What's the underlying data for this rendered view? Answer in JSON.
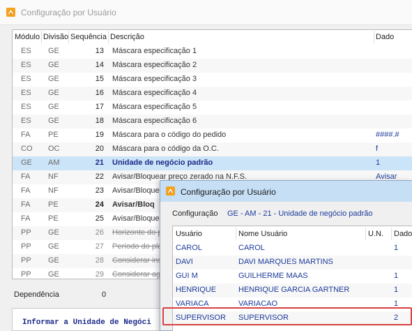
{
  "main_window": {
    "title": "Configuração por Usuário",
    "grid": {
      "columns": [
        "Módulo",
        "Divisão",
        "Sequência",
        "Descrição",
        "Dado"
      ],
      "rows": [
        {
          "modulo": "ES",
          "divisao": "GE",
          "seq": "13",
          "descricao": "Máscara especificação 1",
          "dado": ""
        },
        {
          "modulo": "ES",
          "divisao": "GE",
          "seq": "14",
          "descricao": "Máscara especificação 2",
          "dado": ""
        },
        {
          "modulo": "ES",
          "divisao": "GE",
          "seq": "15",
          "descricao": "Máscara especificação 3",
          "dado": ""
        },
        {
          "modulo": "ES",
          "divisao": "GE",
          "seq": "16",
          "descricao": "Máscara especificação 4",
          "dado": ""
        },
        {
          "modulo": "ES",
          "divisao": "GE",
          "seq": "17",
          "descricao": "Máscara especificação 5",
          "dado": ""
        },
        {
          "modulo": "ES",
          "divisao": "GE",
          "seq": "18",
          "descricao": "Máscara especificação 6",
          "dado": ""
        },
        {
          "modulo": "FA",
          "divisao": "PE",
          "seq": "19",
          "descricao": "Máscara para o código do pedido",
          "dado": "####.#"
        },
        {
          "modulo": "CO",
          "divisao": "OC",
          "seq": "20",
          "descricao": "Máscara para o código da O.C.",
          "dado": "f"
        },
        {
          "modulo": "GE",
          "divisao": "AM",
          "seq": "21",
          "descricao": "Unidade de negócio padrão",
          "dado": "1"
        },
        {
          "modulo": "FA",
          "divisao": "NF",
          "seq": "22",
          "descricao": "Avisar/Bloquear preço zerado na N.F.S.",
          "dado": "Avisar"
        },
        {
          "modulo": "FA",
          "divisao": "NF",
          "seq": "23",
          "descricao": "Avisar/Bloquear",
          "dado": ""
        },
        {
          "modulo": "FA",
          "divisao": "PE",
          "seq": "24",
          "descricao": "Avisar/Bloq",
          "dado": ""
        },
        {
          "modulo": "FA",
          "divisao": "PE",
          "seq": "25",
          "descricao": "Avisar/Bloquear",
          "dado": ""
        },
        {
          "modulo": "PP",
          "divisao": "GE",
          "seq": "26",
          "descricao": "Horizonte do p",
          "dado": ""
        },
        {
          "modulo": "PP",
          "divisao": "GE",
          "seq": "27",
          "descricao": "Período do pla",
          "dado": ""
        },
        {
          "modulo": "PP",
          "divisao": "GE",
          "seq": "28",
          "descricao": "Considerar ins",
          "dado": ""
        },
        {
          "modulo": "PP",
          "divisao": "GE",
          "seq": "29",
          "descricao": "Considerar ag",
          "dado": ""
        }
      ]
    },
    "dependencia_label": "Dependência",
    "dependencia_value": "0",
    "info_text": "Informar a Unidade de Negóci"
  },
  "popup_window": {
    "title": "Configuração por Usuário",
    "config_label": "Configuração",
    "config_value": "GE - AM - 21 - Unidade de negócio padrão",
    "columns": [
      "Usuário",
      "Nome Usuário",
      "U.N.",
      "Dado"
    ],
    "rows": [
      {
        "usuario": "CAROL",
        "nome": "CAROL",
        "un": "",
        "dado": "1"
      },
      {
        "usuario": "DAVI",
        "nome": "DAVI MARQUES MARTINS",
        "un": "",
        "dado": ""
      },
      {
        "usuario": "GUI M",
        "nome": "GUILHERME MAAS",
        "un": "",
        "dado": "1"
      },
      {
        "usuario": "HENRIQUE",
        "nome": "HENRIQUE GARCIA GARTNER",
        "un": "",
        "dado": "1"
      },
      {
        "usuario": "VARIACA",
        "nome": "VARIACAO",
        "un": "",
        "dado": "1"
      },
      {
        "usuario": "SUPERVISOR",
        "nome": "SUPERVISOR",
        "un": "",
        "dado": "2"
      }
    ]
  },
  "colors": {
    "selection": "#cce4f7",
    "highlight_border": "#d94040",
    "link_blue": "#1b3a9a"
  },
  "icons": {
    "app": "app-logo-icon"
  }
}
